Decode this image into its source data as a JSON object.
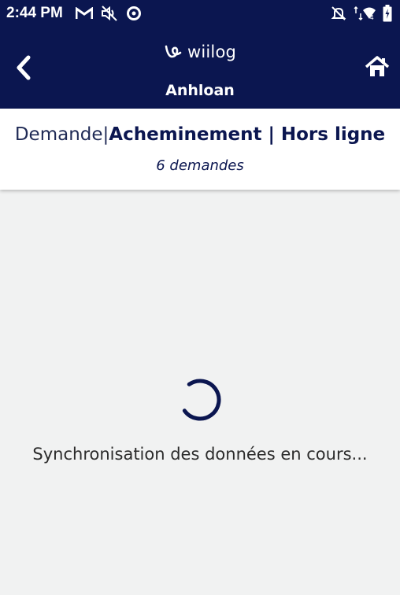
{
  "status_bar": {
    "time": "2:44 PM",
    "left_icons": [
      "gmail-icon",
      "mute-icon",
      "data-saver-icon"
    ],
    "right_icons": [
      "notifications-off-icon",
      "wifi-icon",
      "battery-icon"
    ],
    "network_label": "4"
  },
  "top_bar": {
    "brand": "wiilog",
    "site_name": "Anhloan",
    "background_color": "#0b1650"
  },
  "header": {
    "title_part1": "Demande",
    "separator": "|",
    "title_part2": "Acheminement | Hors ligne",
    "subtitle": "6 demandes"
  },
  "main": {
    "sync_message": "Synchronisation des données en cours..."
  }
}
